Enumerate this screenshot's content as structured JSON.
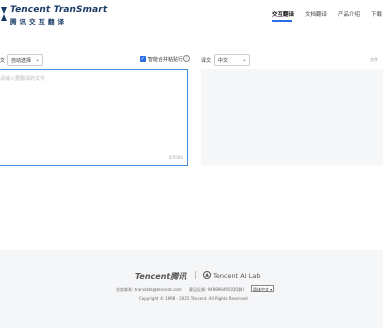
{
  "header": {
    "logo_en": "Tencent TranSmart",
    "logo_cn": "腾讯交互翻译",
    "nav": [
      {
        "label": "交互翻译",
        "active": true
      },
      {
        "label": "文档翻译",
        "active": false
      },
      {
        "label": "产品介绍",
        "active": false
      },
      {
        "label": "下载",
        "active": false
      }
    ]
  },
  "toolbar": {
    "src_prefix": "文",
    "src_language": "自动选择",
    "smart_merge_label": "智能合并粘贴行",
    "smart_merge_checked": true,
    "tgt_prefix": "译文",
    "tgt_language": "中文",
    "right_hint": "文件"
  },
  "editor": {
    "placeholder": "请输入要翻译的文字",
    "counter": "0/5000"
  },
  "footer": {
    "tencent_logo": "Tencent腾讯",
    "ai_lab": "Tencent AI Lab",
    "contact": "业务联系: translate@tencent.com",
    "feedback": "意见反馈: 949896495(QQ群)",
    "language_select": "简体中文 ▾",
    "copyright": "Copyright © 1998 - 2025 Tencent. All Rights Reserved."
  },
  "colors": {
    "accent": "#2a6de5",
    "brand": "#1a3a66",
    "footer_bg": "#f5f6f8"
  }
}
